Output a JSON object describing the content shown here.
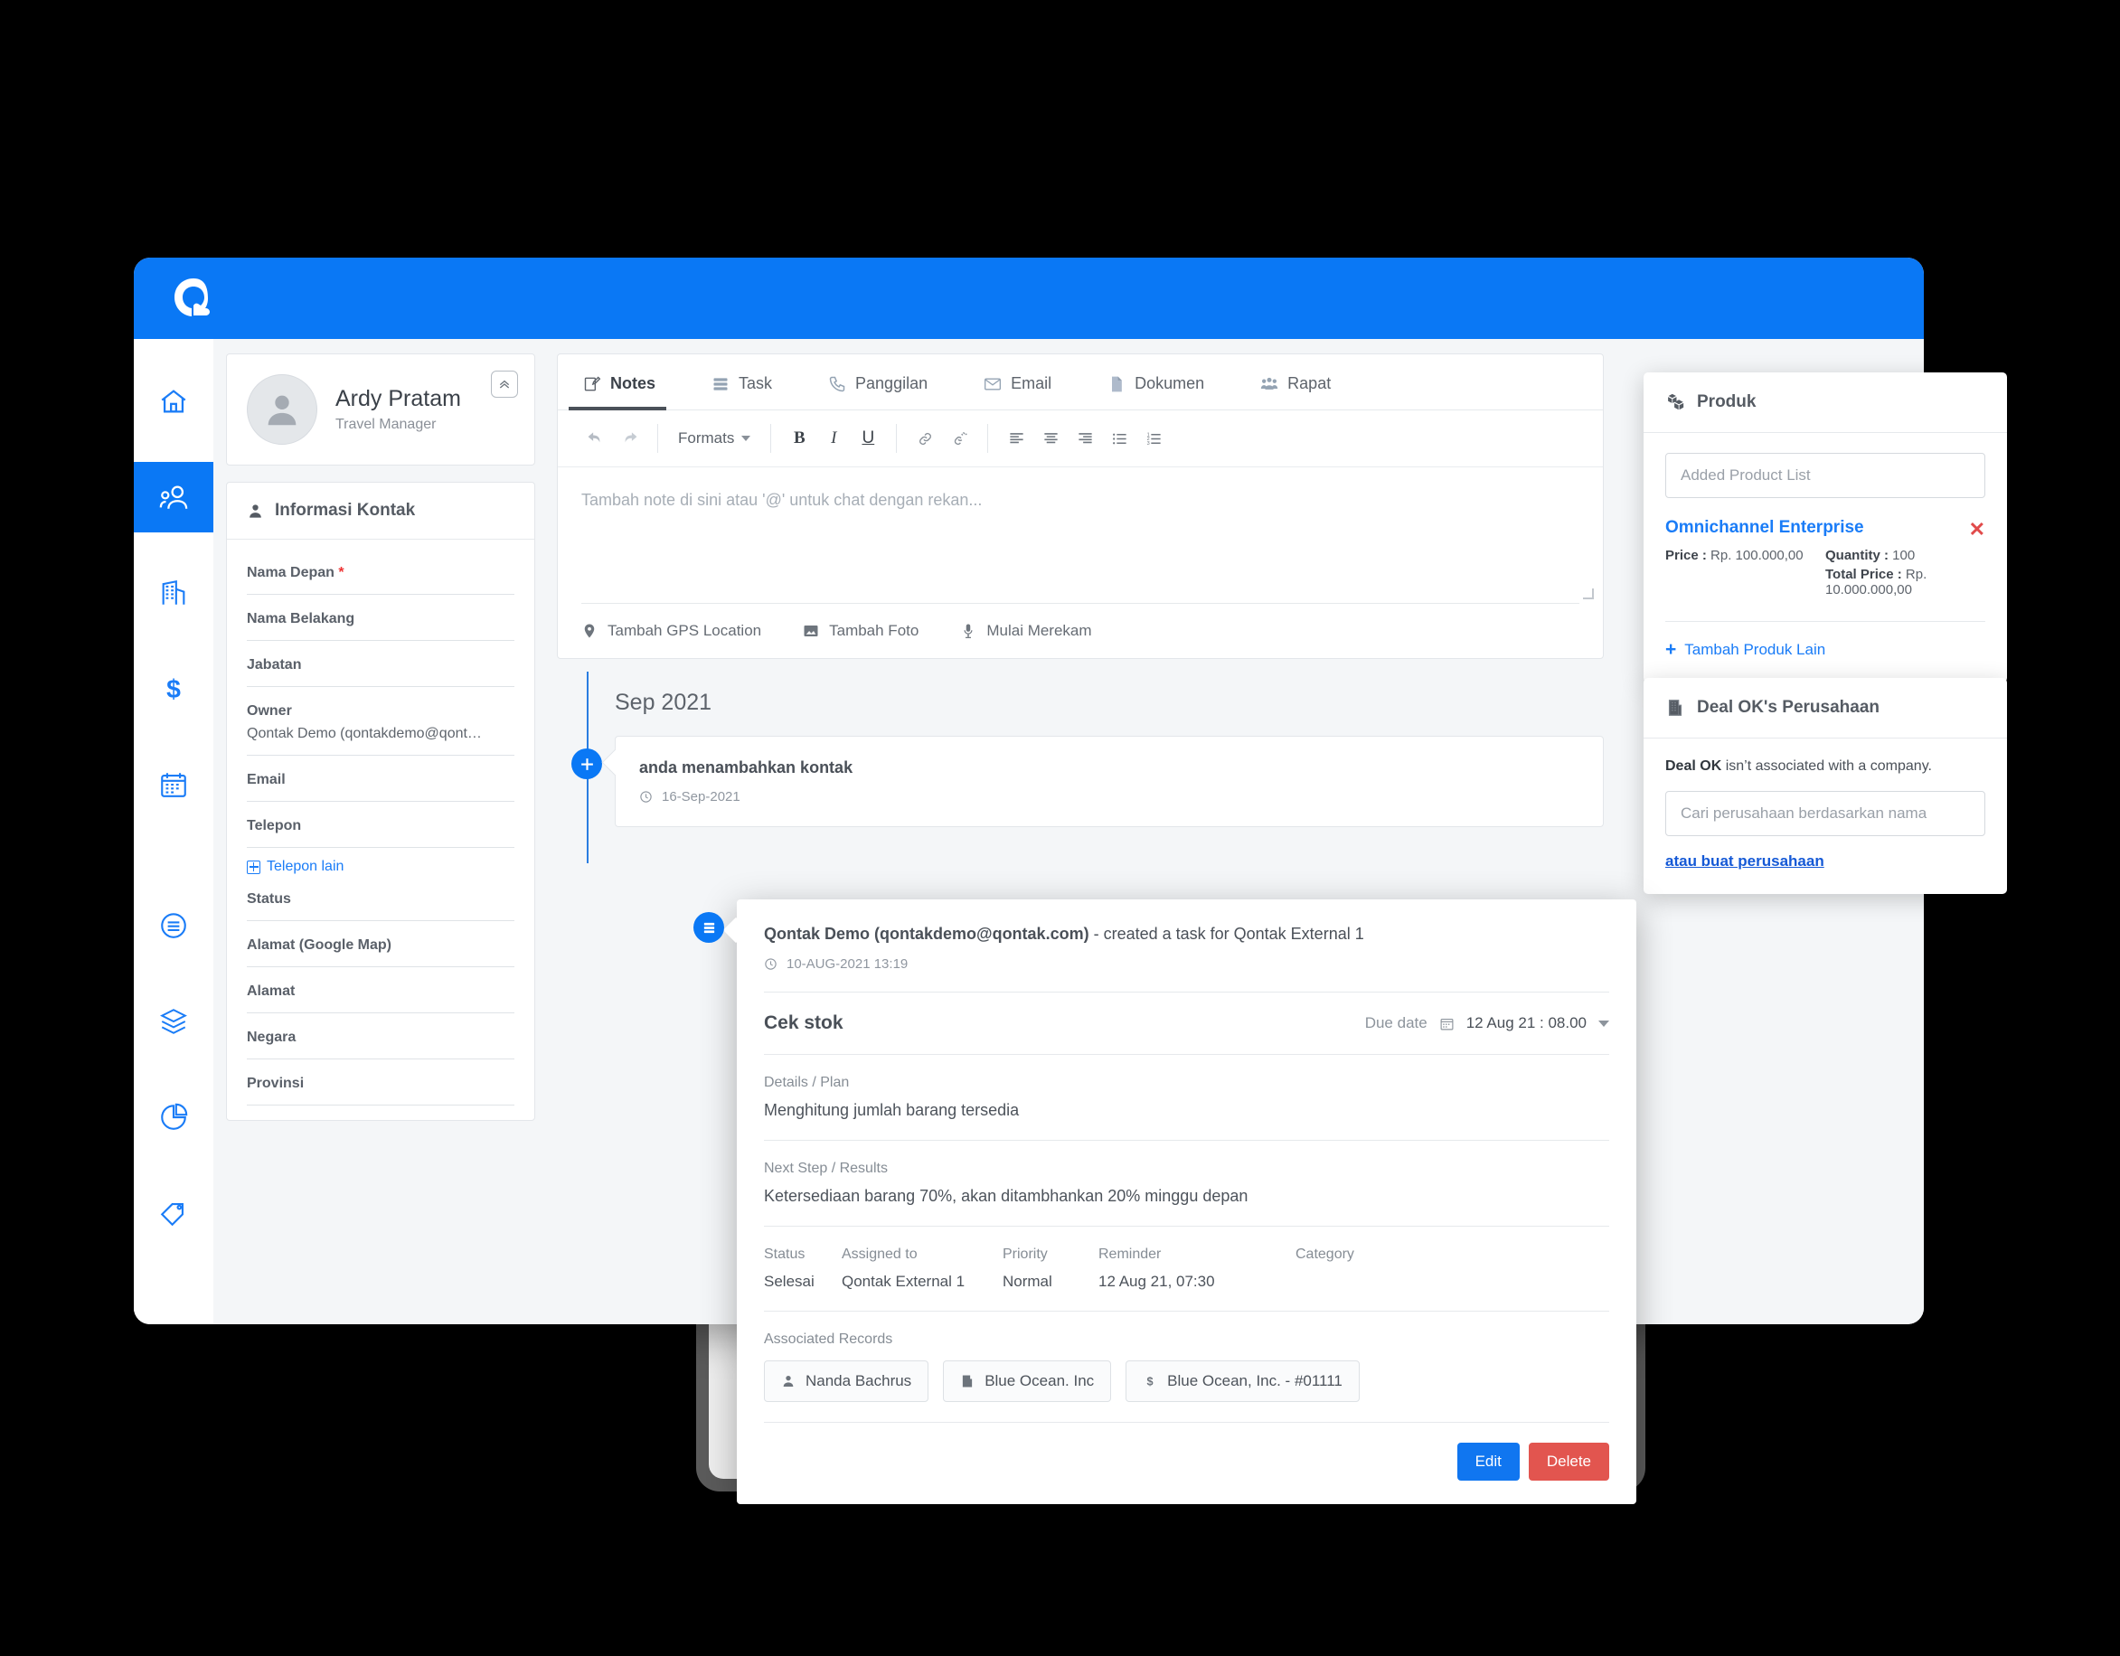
{
  "app": {
    "logo_alt": "qontak-logo",
    "brand_color": "#0a78f5"
  },
  "sidebar": {
    "items": [
      {
        "name": "home",
        "icon": "home-icon",
        "active": false
      },
      {
        "name": "contacts",
        "icon": "users-icon",
        "active": true
      },
      {
        "name": "companies",
        "icon": "building-icon",
        "active": false
      },
      {
        "name": "deals",
        "icon": "dollar-icon",
        "active": false
      },
      {
        "name": "calendar",
        "icon": "calendar-icon",
        "active": false
      },
      {
        "name": "activities",
        "icon": "list-circle-icon",
        "active": false
      },
      {
        "name": "products",
        "icon": "layers-icon",
        "active": false
      },
      {
        "name": "reports",
        "icon": "pie-chart-icon",
        "active": false
      },
      {
        "name": "tags",
        "icon": "tag-icon",
        "active": false
      }
    ]
  },
  "profile": {
    "name": "Ardy Pratam",
    "role": "Travel Manager",
    "collapse_icon": "chevron-double-up-icon"
  },
  "contact_info": {
    "header": "Informasi Kontak",
    "header_icon": "person-icon",
    "fields": [
      {
        "label": "Nama Depan",
        "required": true,
        "value": ""
      },
      {
        "label": "Nama Belakang",
        "required": false,
        "value": ""
      },
      {
        "label": "Jabatan",
        "required": false,
        "value": ""
      },
      {
        "label": "Owner",
        "required": false,
        "value": "Qontak Demo (qontakdemo@qont…"
      },
      {
        "label": "Email",
        "required": false,
        "value": ""
      },
      {
        "label": "Telepon",
        "required": false,
        "value": ""
      }
    ],
    "add_phone_link": "Telepon lain",
    "fields2": [
      {
        "label": "Status",
        "required": false,
        "value": ""
      },
      {
        "label": "Alamat (Google Map)",
        "required": false,
        "value": ""
      },
      {
        "label": "Alamat",
        "required": false,
        "value": ""
      },
      {
        "label": "Negara",
        "required": false,
        "value": ""
      },
      {
        "label": "Provinsi",
        "required": false,
        "value": ""
      }
    ]
  },
  "tabs": [
    {
      "label": "Notes",
      "icon": "note-edit-icon",
      "active": true
    },
    {
      "label": "Task",
      "icon": "task-list-icon",
      "active": false
    },
    {
      "label": "Panggilan",
      "icon": "phone-icon",
      "active": false
    },
    {
      "label": "Email",
      "icon": "envelope-icon",
      "active": false
    },
    {
      "label": "Dokumen",
      "icon": "document-icon",
      "active": false
    },
    {
      "label": "Rapat",
      "icon": "group-meeting-icon",
      "active": false
    }
  ],
  "editor": {
    "toolbar": {
      "undo": "undo-icon",
      "redo": "redo-icon",
      "formats_label": "Formats",
      "bold": "B",
      "italic": "I",
      "underline": "U",
      "link": "link-icon",
      "unlink": "unlink-icon",
      "align_left": "align-left-icon",
      "align_center": "align-center-icon",
      "align_right": "align-right-icon",
      "bullet_list": "bullet-list-icon",
      "numbered_list": "numbered-list-icon"
    },
    "placeholder": "Tambah note di sini atau '@' untuk chat dengan rekan...",
    "actions": [
      {
        "label": "Tambah GPS Location",
        "icon": "map-pin-icon"
      },
      {
        "label": "Tambah Foto",
        "icon": "image-icon"
      },
      {
        "label": "Mulai Merekam",
        "icon": "microphone-icon"
      }
    ]
  },
  "timeline": {
    "month": "Sep 2021",
    "entries": [
      {
        "title": "anda menambahkan kontak",
        "time": "16-Sep-2021",
        "icon": "plus-icon"
      }
    ]
  },
  "task_popup": {
    "icon": "task-list-icon",
    "header_actor": "Qontak Demo (qontakdemo@qontak.com)",
    "header_action": " - created a task for Qontak External 1",
    "timestamp": "10-AUG-2021 13:19",
    "subject": "Cek stok",
    "due_label": "Due date",
    "due_icon": "calendar-icon",
    "due_value": "12 Aug 21 : 08.00",
    "details_label": "Details / Plan",
    "details_value": "Menghitung jumlah barang tersedia",
    "next_label": "Next Step / Results",
    "next_value": "Ketersediaan barang 70%, akan ditambhankan 20% minggu depan",
    "meta": [
      {
        "label": "Status",
        "value": "Selesai"
      },
      {
        "label": "Assigned to",
        "value": "Qontak External 1"
      },
      {
        "label": "Priority",
        "value": "Normal"
      },
      {
        "label": "Reminder",
        "value": "12 Aug 21, 07:30"
      },
      {
        "label": "Category",
        "value": ""
      }
    ],
    "associated_label": "Associated Records",
    "associated": [
      {
        "label": "Nanda Bachrus",
        "icon": "person-icon"
      },
      {
        "label": "Blue Ocean. Inc",
        "icon": "building-icon"
      },
      {
        "label": "Blue Ocean, Inc. - #01111",
        "icon": "dollar-icon"
      }
    ],
    "edit_label": "Edit",
    "delete_label": "Delete",
    "edit_color": "#1076f0",
    "delete_color": "#e2554f"
  },
  "produk_panel": {
    "title": "Produk",
    "icon": "cubes-icon",
    "search_placeholder": "Added Product List",
    "product_name": "Omnichannel Enterprise",
    "remove_icon": "x-icon",
    "price_label": "Price :",
    "price_value": "Rp. 100.000,00",
    "quantity_label": "Quantity :",
    "quantity_value": "100",
    "total_label": "Total Price :",
    "total_value": "Rp. 10.000.000,00",
    "add_link": "Tambah Produk Lain"
  },
  "deal_panel": {
    "title": "Deal OK's Perusahaan",
    "icon": "building-icon",
    "message_bold": "Deal OK",
    "message_rest": " isn’t associated with a company.",
    "search_placeholder": "Cari perusahaan berdasarkan nama",
    "create_link": "atau buat perusahaan"
  }
}
